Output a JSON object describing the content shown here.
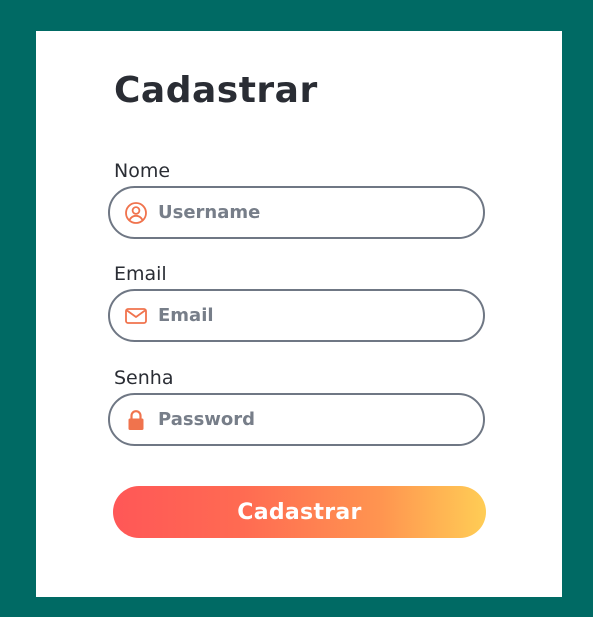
{
  "form": {
    "title": "Cadastrar",
    "fields": [
      {
        "label": "Nome",
        "placeholder": "Username",
        "value": "",
        "icon": "user-circle-icon"
      },
      {
        "label": "Email",
        "placeholder": "Email",
        "value": "",
        "icon": "envelope-icon"
      },
      {
        "label": "Senha",
        "placeholder": "Password",
        "value": "",
        "icon": "lock-icon"
      }
    ],
    "submit_label": "Cadastrar"
  },
  "colors": {
    "background": "#006a64",
    "card": "#ffffff",
    "text": "#2a2d34",
    "input_border": "#6f7784",
    "icon_accent": "#f0734d",
    "button_gradient_start": "#ff5757",
    "button_gradient_end": "#ffcd55"
  }
}
